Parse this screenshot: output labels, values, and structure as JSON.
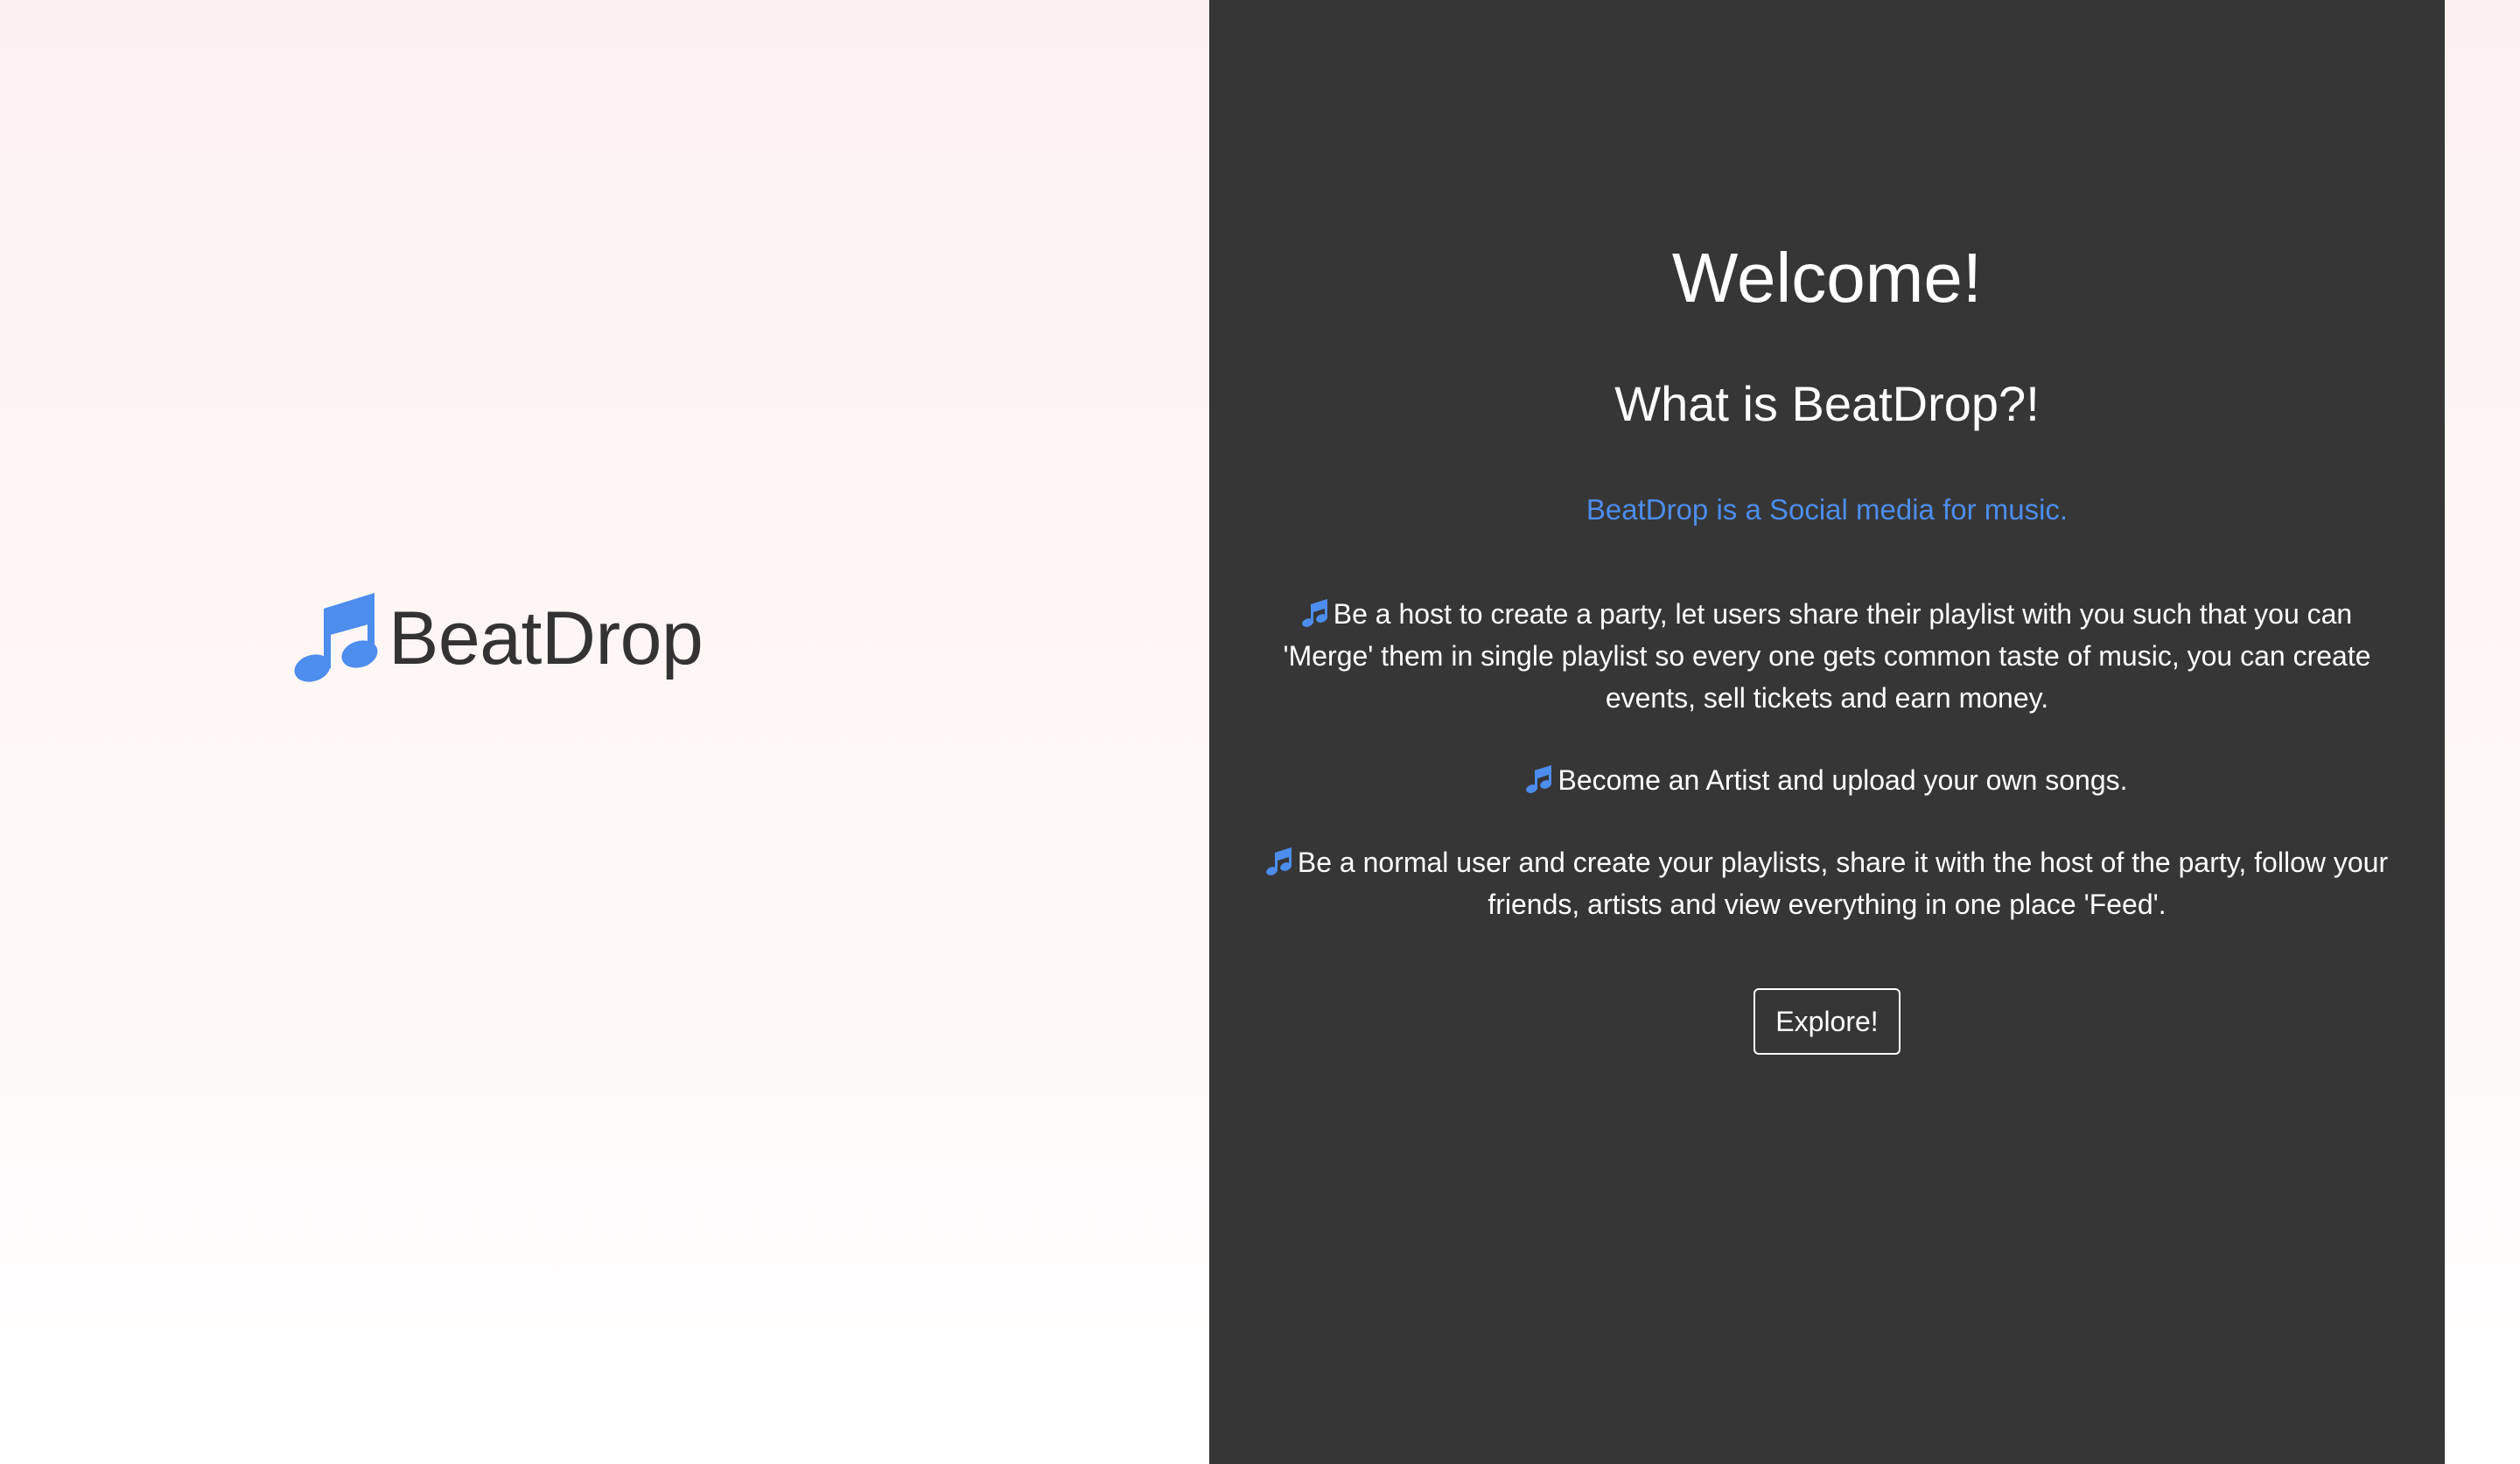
{
  "brand": {
    "name": "BeatDrop",
    "icon": "music-note-icon",
    "accent_color": "#4c8ded"
  },
  "hero": {
    "welcome": "Welcome!",
    "subtitle": "What is BeatDrop?!",
    "tagline": "BeatDrop is a Social media for music."
  },
  "features": [
    {
      "icon": "music-note-icon",
      "text": "Be a host to create a party, let users share their playlist with you such that you can 'Merge' them in single playlist so every one gets common taste of music, you can create events, sell tickets and earn money."
    },
    {
      "icon": "music-note-icon",
      "text": "Become an Artist and upload your own songs."
    },
    {
      "icon": "music-note-icon",
      "text": "Be a normal user and create your playlists, share it with the host of the party, follow your friends, artists and view everything in one place 'Feed'."
    }
  ],
  "actions": {
    "explore_label": "Explore!"
  },
  "colors": {
    "panel_background": "#363636",
    "text_on_panel": "#ffffff",
    "logo_text": "#333333"
  }
}
